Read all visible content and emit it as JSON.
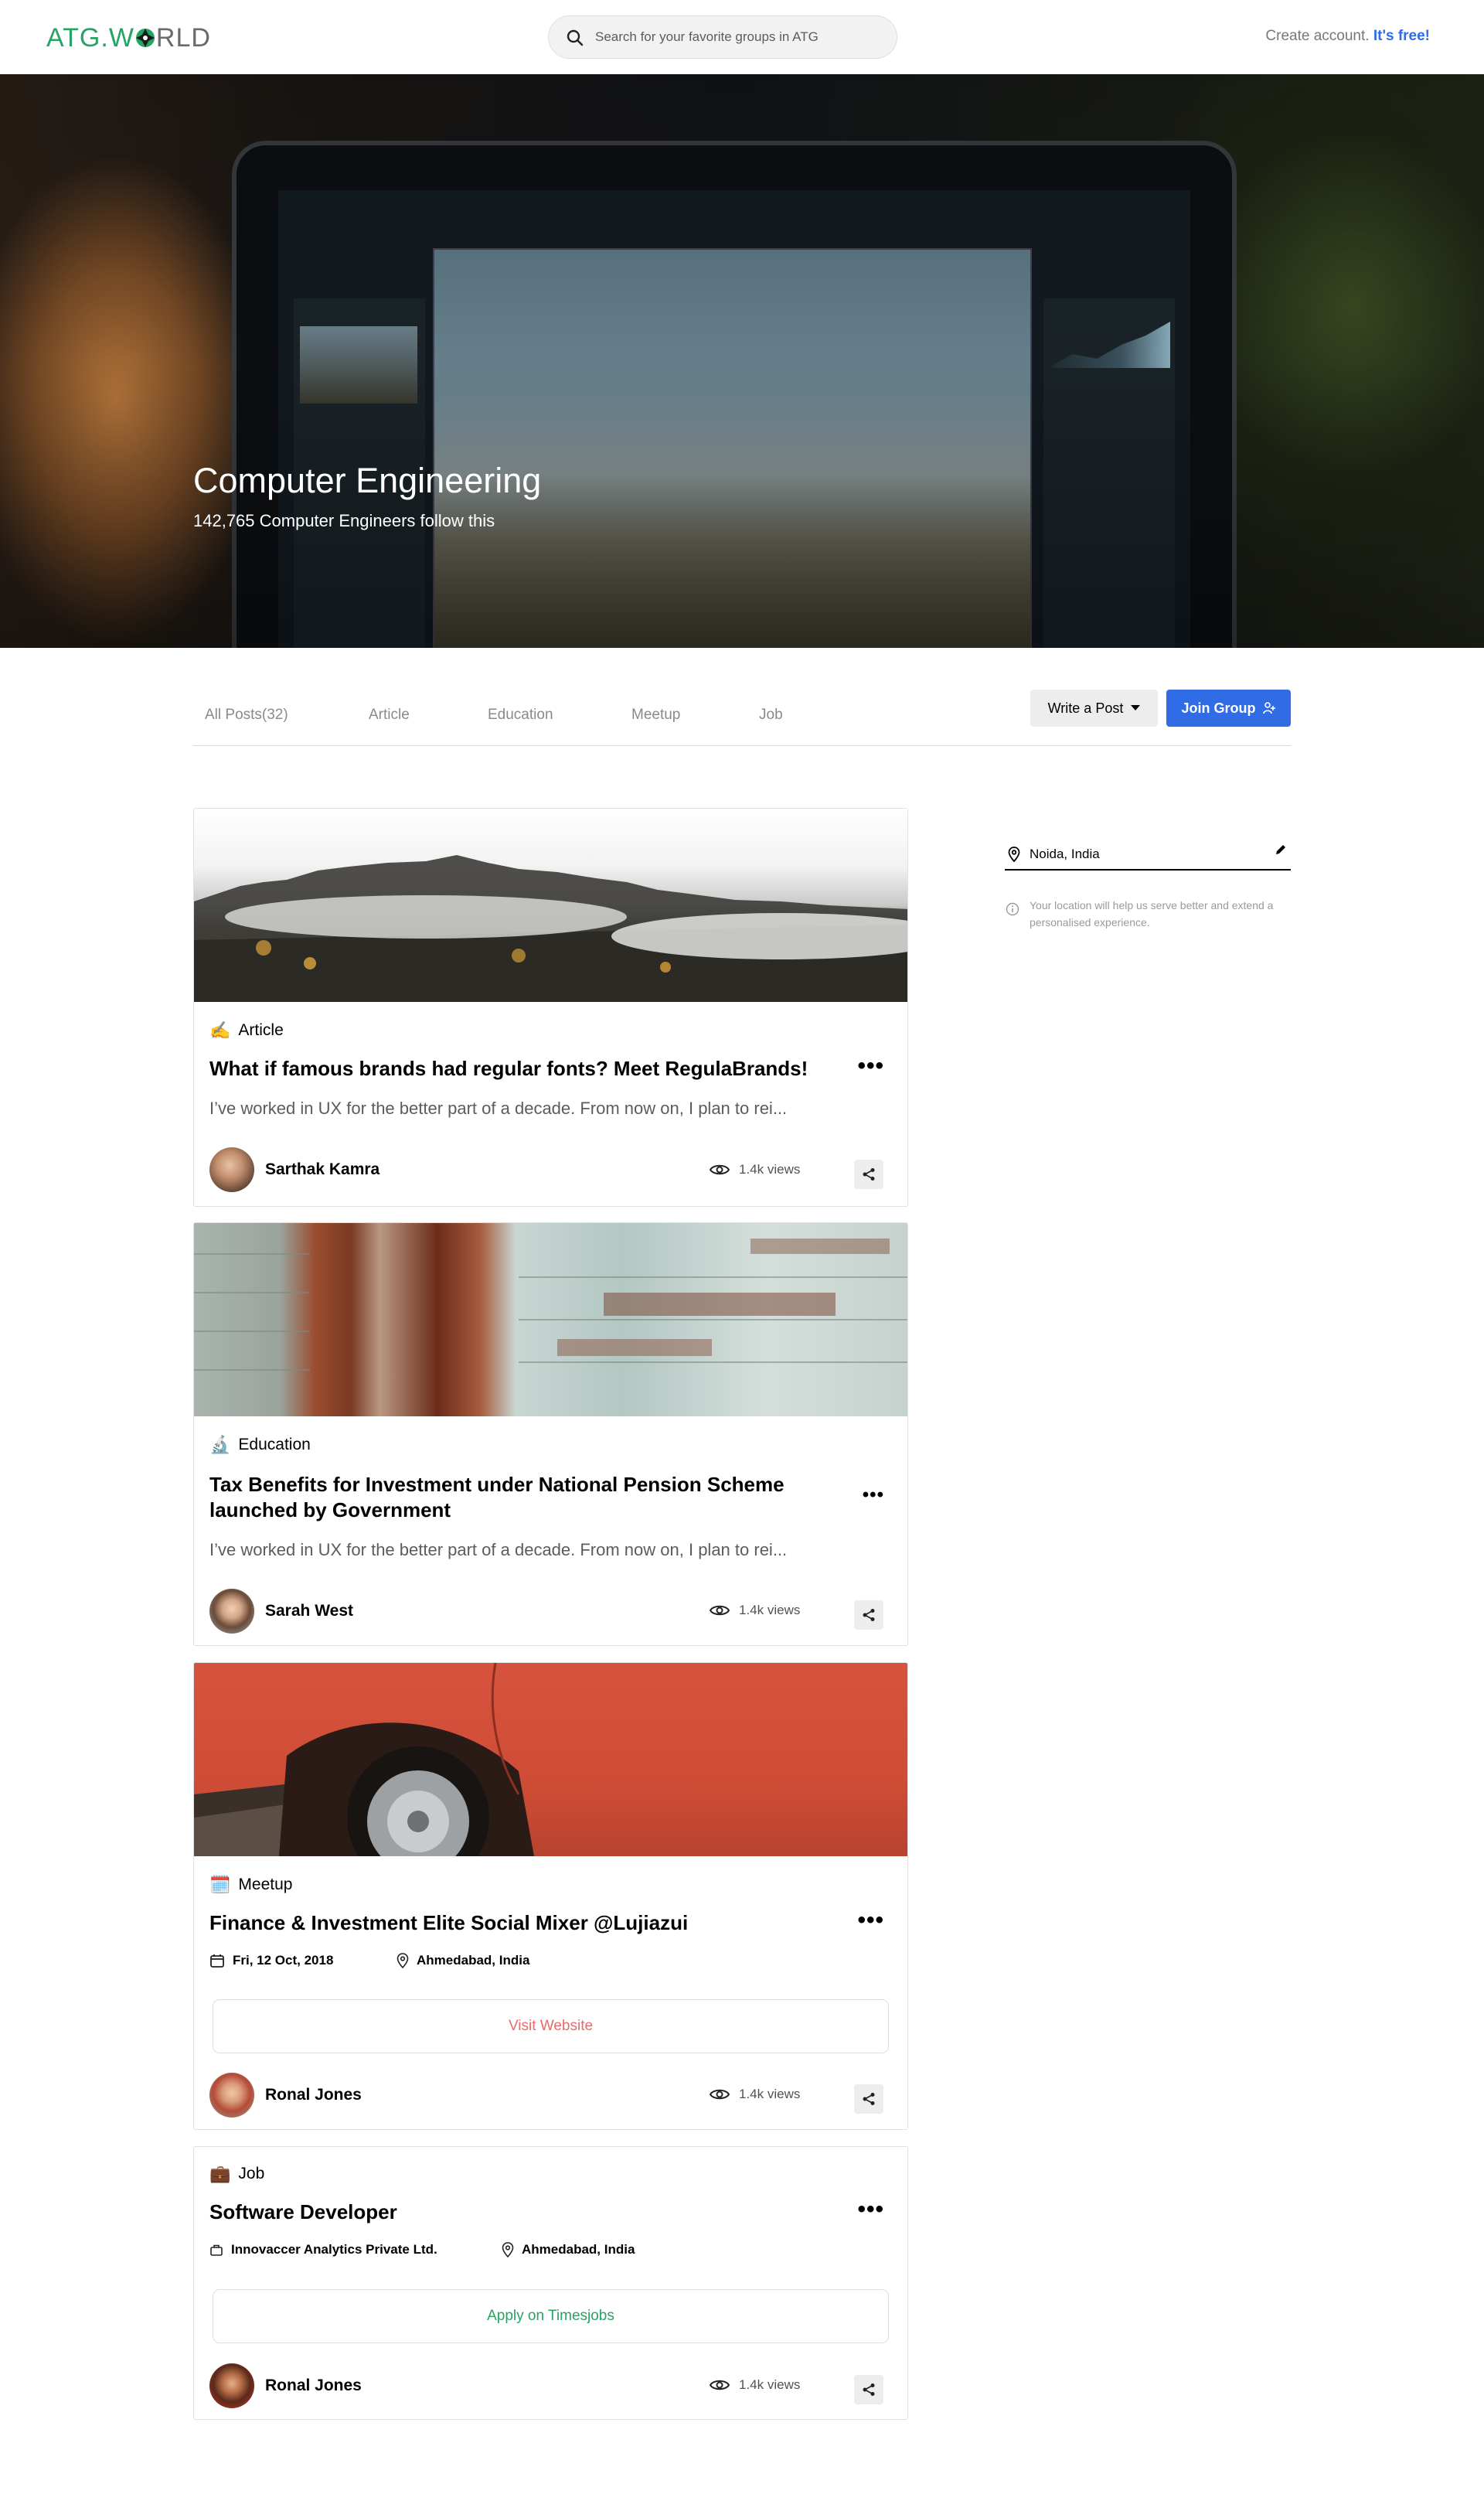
{
  "header": {
    "logo_text_left": "ATG.W",
    "logo_text_right": "RLD",
    "search_placeholder": "Search for your favorite groups in ATG",
    "account_text": "Create account.",
    "account_cta": "It's free!"
  },
  "hero": {
    "title": "Computer Engineering",
    "subtitle": "142,765 Computer Engineers follow this"
  },
  "tabs": [
    {
      "label": "All Posts(32)"
    },
    {
      "label": "Article"
    },
    {
      "label": "Education"
    },
    {
      "label": "Meetup"
    },
    {
      "label": "Job"
    }
  ],
  "actions": {
    "write_post": "Write a Post",
    "join_group": "Join Group"
  },
  "posts": [
    {
      "category": "Article",
      "category_icon": "✍️",
      "title": "What if famous brands had regular fonts? Meet RegulaBrands!",
      "excerpt": "I’ve worked in UX for the better part of a decade. From now on, I plan to rei...",
      "author": "Sarthak Kamra",
      "views": "1.4k views"
    },
    {
      "category": "Education",
      "category_icon": "🔬",
      "title": "Tax Benefits for Investment under National Pension Scheme launched by Government",
      "excerpt": "I’ve worked in UX for the better part of a decade. From now on, I plan to rei...",
      "author": "Sarah West",
      "views": "1.4k views"
    },
    {
      "category": "Meetup",
      "category_icon": "🗓️",
      "title": "Finance & Investment Elite Social Mixer @Lujiazui",
      "date": "Fri, 12 Oct, 2018",
      "location": "Ahmedabad, India",
      "button": "Visit Website",
      "author": "Ronal Jones",
      "views": "1.4k views"
    },
    {
      "category": "Job",
      "category_icon": "💼",
      "title": "Software Developer",
      "company": "Innovaccer Analytics Private Ltd.",
      "location": "Ahmedabad, India",
      "button": "Apply on Timesjobs",
      "author": "Ronal Jones",
      "views": "1.4k views"
    }
  ],
  "sidebar": {
    "location": "Noida, India",
    "note": "Your location will help us serve better and extend a personalised experience."
  },
  "colors": {
    "brand_green": "#27a365",
    "accent_blue": "#2f6ce5",
    "visit_red": "#e56c6c",
    "apply_green": "#27a365"
  }
}
